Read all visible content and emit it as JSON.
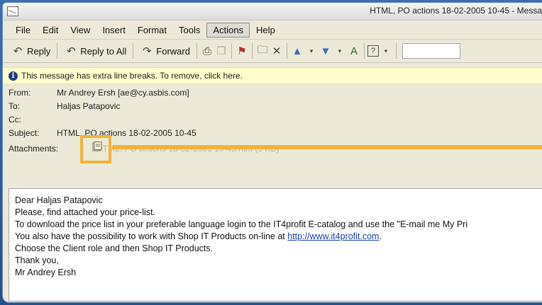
{
  "window": {
    "title": "HTML, PO actions 18-02-2005 10-45 - Messa"
  },
  "menu": {
    "items": [
      "File",
      "Edit",
      "View",
      "Insert",
      "Format",
      "Tools",
      "Actions",
      "Help"
    ],
    "active": "Actions"
  },
  "toolbar": {
    "reply_label": "Reply",
    "reply_all_label": "Reply to All",
    "forward_label": "Forward"
  },
  "infobar": {
    "text": "This message has extra line breaks. To remove, click here."
  },
  "header": {
    "from_label": "From:",
    "from_value": "Mr Andrey Ersh [ae@cy.asbis.com]",
    "to_label": "To:",
    "to_value": "Haljas Patapovic",
    "cc_label": "Cc:",
    "cc_value": "",
    "subject_label": "Subject:",
    "subject_value": "HTML, PO actions 18-02-2005 10-45",
    "attachments_label": "Attachments:",
    "attachments_value": "HTML, PO actions 18-02-2005 10-45.htm (9 KB)"
  },
  "body": {
    "lines": [
      "Dear Haljas  Patapovic",
      "Please, find attached your price-list.",
      "To download the price list in your preferable language login to the IT4profit E-catalog and use the \"E-mail me My Pri",
      "You also have the possibility to work with Shop IT Products on-line at ",
      "Choose the Client role and then Shop IT Products.",
      "Thank you,",
      "Mr Andrey  Ersh"
    ],
    "link": "http://www.it4profit.com"
  },
  "colors": {
    "highlight": "#f0b437",
    "frame_bg": "#2d5d9c",
    "infobar_bg": "#fffdcc"
  }
}
